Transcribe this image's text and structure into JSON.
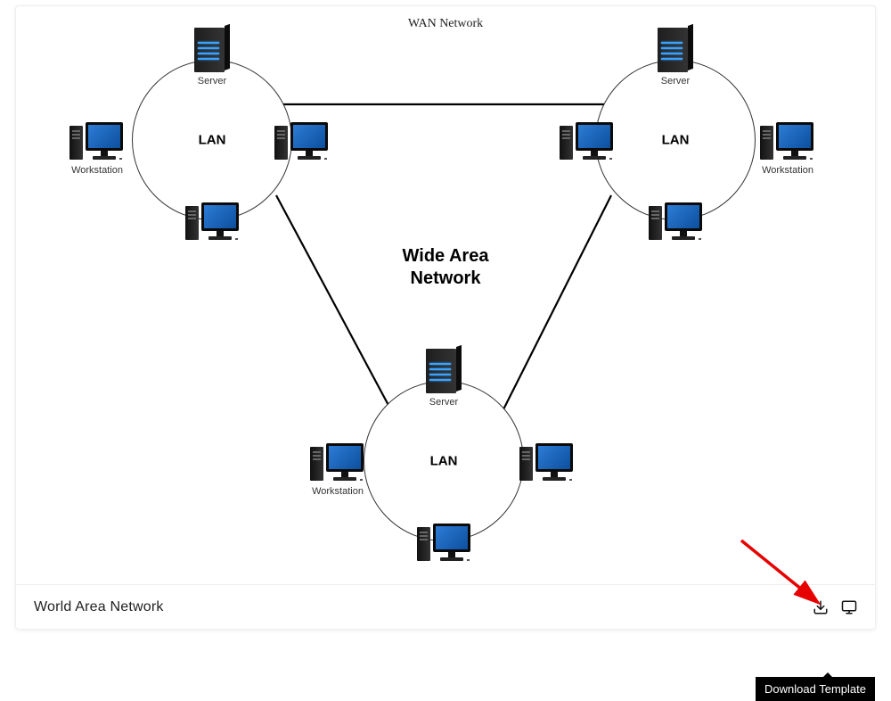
{
  "diagram": {
    "title_top": "WAN Network",
    "center_title_line1": "Wide Area",
    "center_title_line2": "Network",
    "clusters": [
      {
        "label": "LAN",
        "server_label": "Server",
        "workstation_label": "Workstation"
      },
      {
        "label": "LAN",
        "server_label": "Server",
        "workstation_label": "Workstation"
      },
      {
        "label": "LAN",
        "server_label": "Server",
        "workstation_label": "Workstation"
      }
    ]
  },
  "footer": {
    "title": "World Area Network"
  },
  "tooltip": "Download Template",
  "icons": {
    "download": "download-icon",
    "monitor": "monitor-icon"
  }
}
